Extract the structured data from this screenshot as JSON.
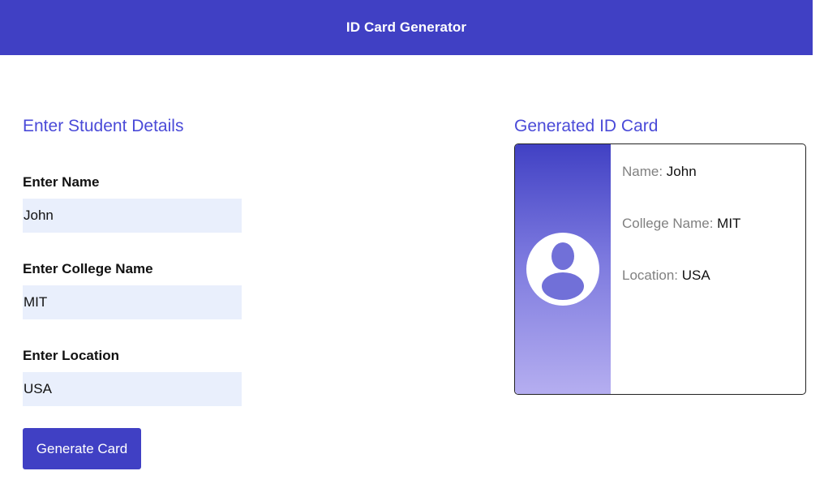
{
  "header": {
    "title": "ID Card Generator"
  },
  "form": {
    "title": "Enter Student Details",
    "fields": [
      {
        "label": "Enter Name",
        "value": "John"
      },
      {
        "label": "Enter College Name",
        "value": "MIT"
      },
      {
        "label": "Enter Location",
        "value": "USA"
      }
    ],
    "button_label": "Generate Card"
  },
  "card": {
    "title": "Generated ID Card",
    "rows": [
      {
        "key": "Name: ",
        "value": "John"
      },
      {
        "key": "College Name: ",
        "value": "MIT"
      },
      {
        "key": "Location: ",
        "value": "USA"
      }
    ],
    "icon": "user-avatar-icon"
  },
  "colors": {
    "accent": "#4040c4",
    "section_title": "#4a4ad8",
    "input_background": "#e9effc",
    "detail_key": "#808080"
  }
}
